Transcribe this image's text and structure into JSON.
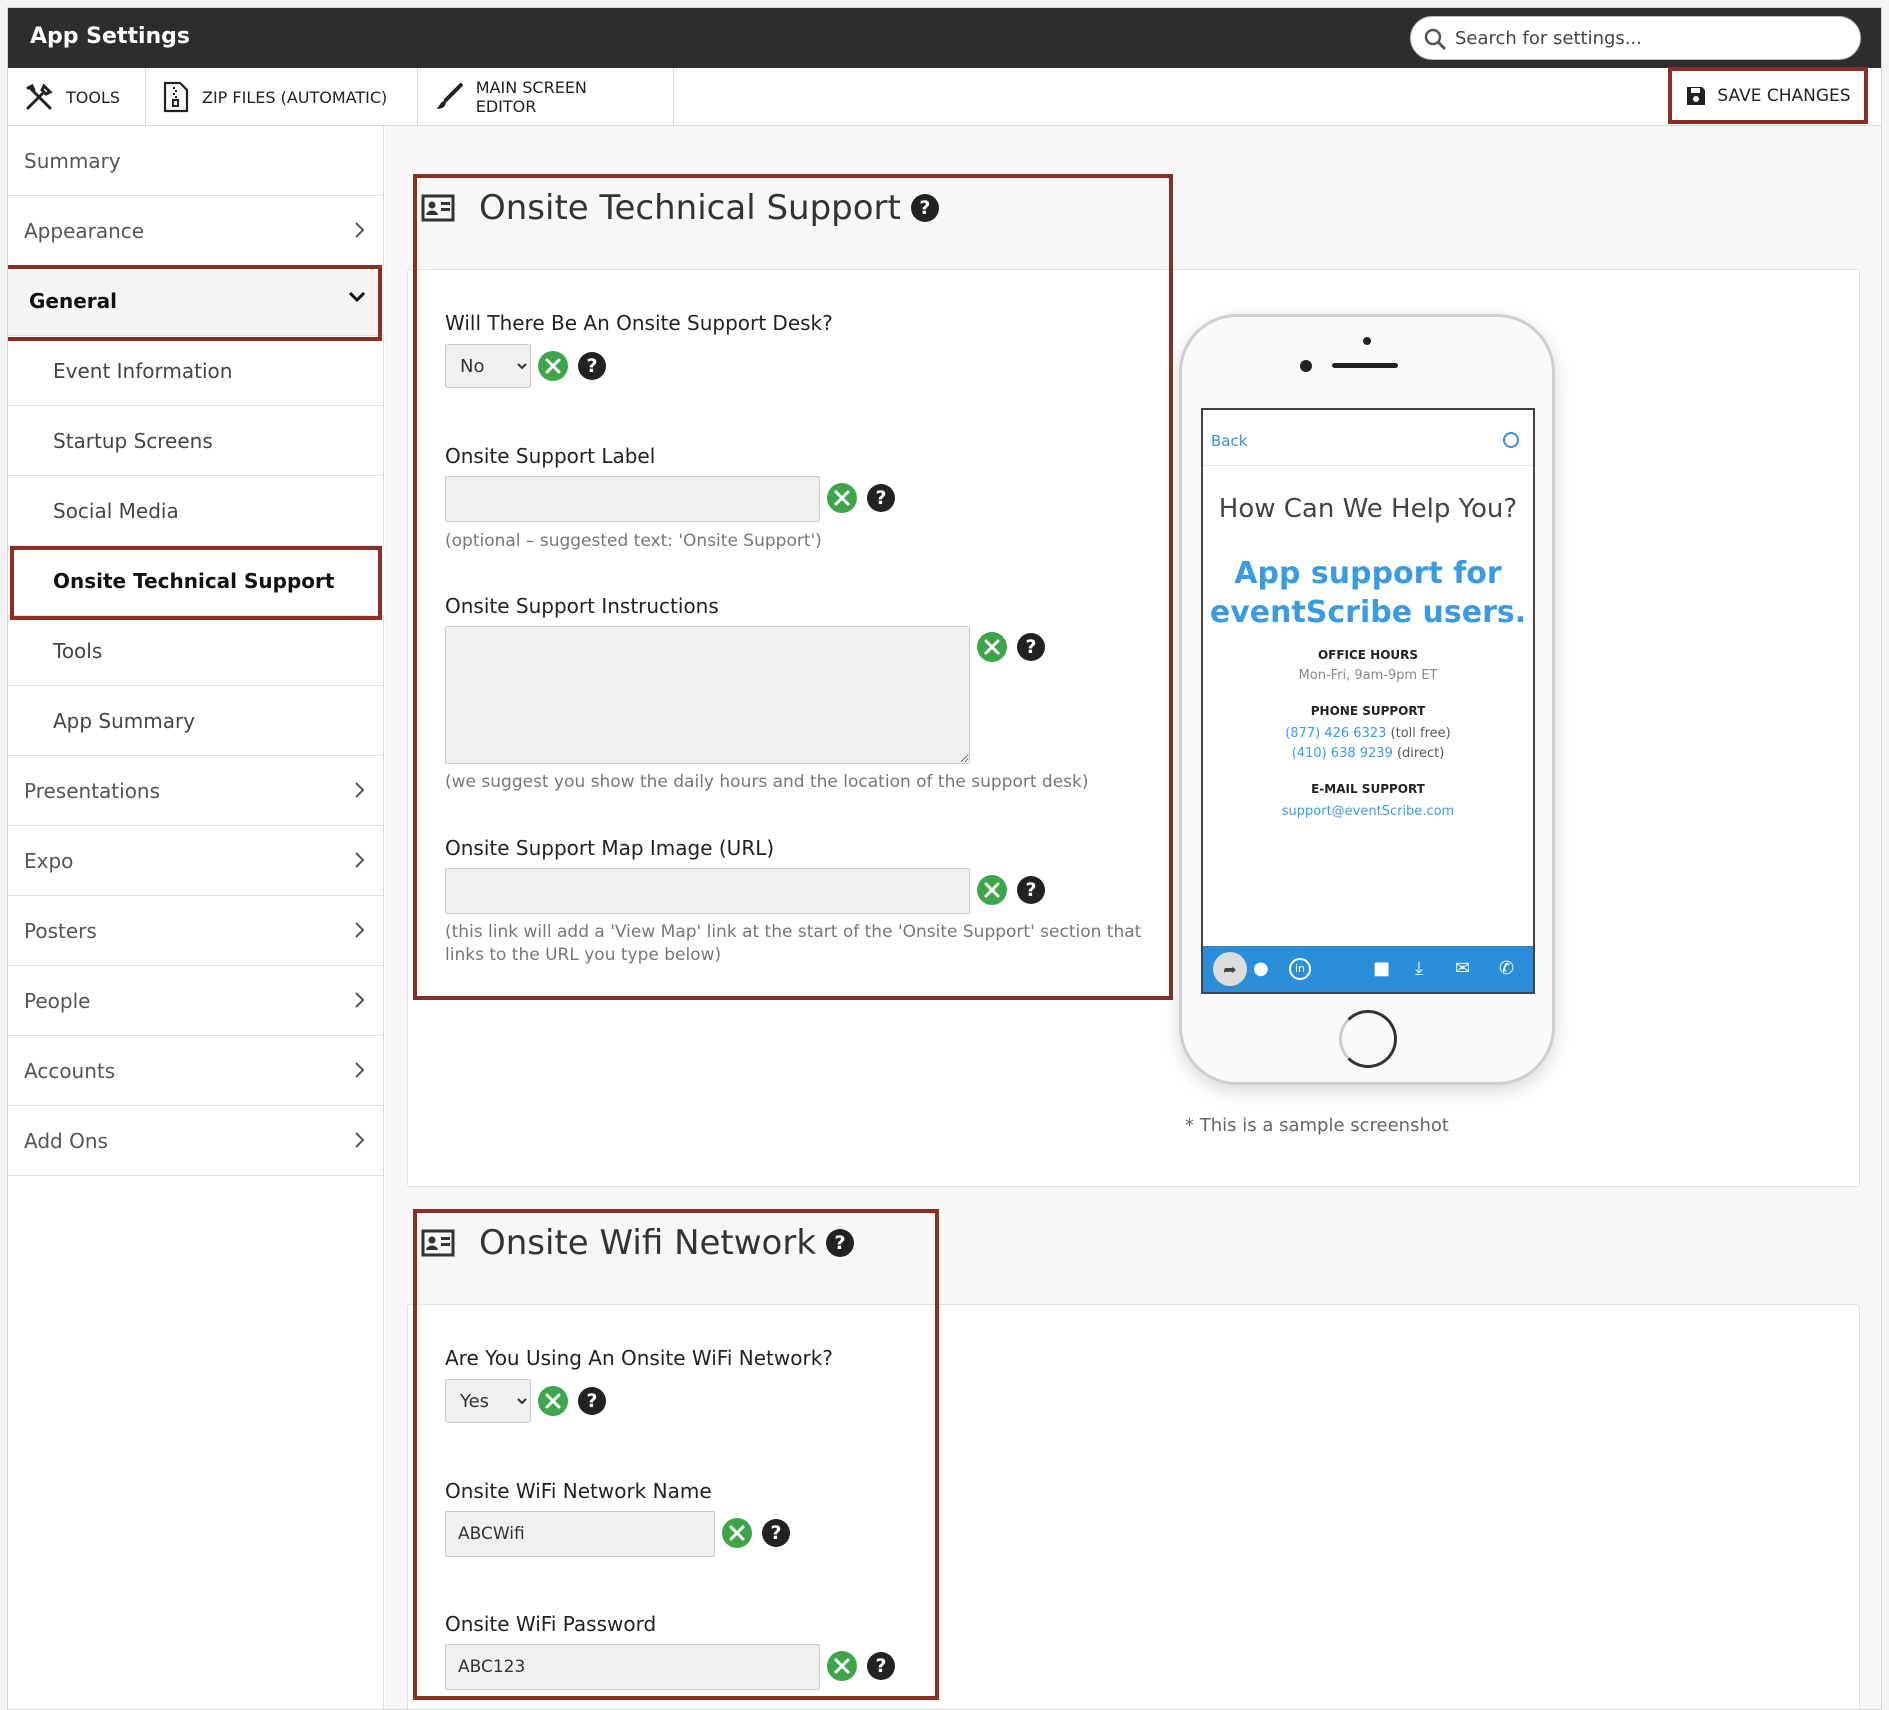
{
  "header": {
    "title": "App Settings",
    "search_placeholder": "Search for settings..."
  },
  "toolbar": {
    "tools_label": "TOOLS",
    "zip_label": "ZIP FILES (AUTOMATIC)",
    "editor_label": "MAIN SCREEN EDITOR",
    "save_label": "SAVE CHANGES"
  },
  "sidebar": {
    "items": [
      {
        "label": "Summary"
      },
      {
        "label": "Appearance"
      },
      {
        "label": "General"
      },
      {
        "label": "Event Information"
      },
      {
        "label": "Startup Screens"
      },
      {
        "label": "Social Media"
      },
      {
        "label": "Onsite Technical Support"
      },
      {
        "label": "Tools"
      },
      {
        "label": "App Summary"
      },
      {
        "label": "Presentations"
      },
      {
        "label": "Expo"
      },
      {
        "label": "Posters"
      },
      {
        "label": "People"
      },
      {
        "label": "Accounts"
      },
      {
        "label": "Add Ons"
      }
    ]
  },
  "support": {
    "title": "Onsite Technical Support",
    "desk_label": "Will There Be An Onsite Support Desk?",
    "desk_value": "No",
    "desk_options": [
      "No",
      "Yes"
    ],
    "label_label": "Onsite Support Label",
    "label_value": "",
    "label_hint": "(optional – suggested text: 'Onsite Support')",
    "instructions_label": "Onsite Support Instructions",
    "instructions_value": "",
    "instructions_hint": "(we suggest you show the daily hours and the location of the support desk)",
    "map_label": "Onsite Support Map Image (URL)",
    "map_value": "",
    "map_hint": "(this link will add a 'View Map' link at the start of the 'Onsite Support' section that links to the URL you type below)"
  },
  "preview": {
    "back": "Back",
    "heading": "How Can We Help You?",
    "tagline_1": "App support for",
    "tagline_2": "eventScribe users.",
    "office_title": "OFFICE HOURS",
    "office_hours": "Mon-Fri, 9am-9pm ET",
    "phone_title": "PHONE SUPPORT",
    "phone_1": "(877) 426 6323",
    "phone_1_note": "(toll free)",
    "phone_2": "(410) 638 9239",
    "phone_2_note": "(direct)",
    "email_title": "E-MAIL SUPPORT",
    "email": "support@eventScribe.com",
    "caption": "* This is a sample screenshot"
  },
  "wifi": {
    "title": "Onsite Wifi Network",
    "using_label": "Are You Using An Onsite WiFi Network?",
    "using_value": "Yes",
    "using_options": [
      "Yes",
      "No"
    ],
    "name_label": "Onsite WiFi Network Name",
    "name_value": "ABCWifi",
    "password_label": "Onsite WiFi Password",
    "password_value": "ABC123"
  },
  "colors": {
    "highlight": "#8b2f24",
    "tool_green": "#3da54a",
    "header_dark": "#2d2d2d",
    "preview_blue": "#2a8fd8"
  }
}
